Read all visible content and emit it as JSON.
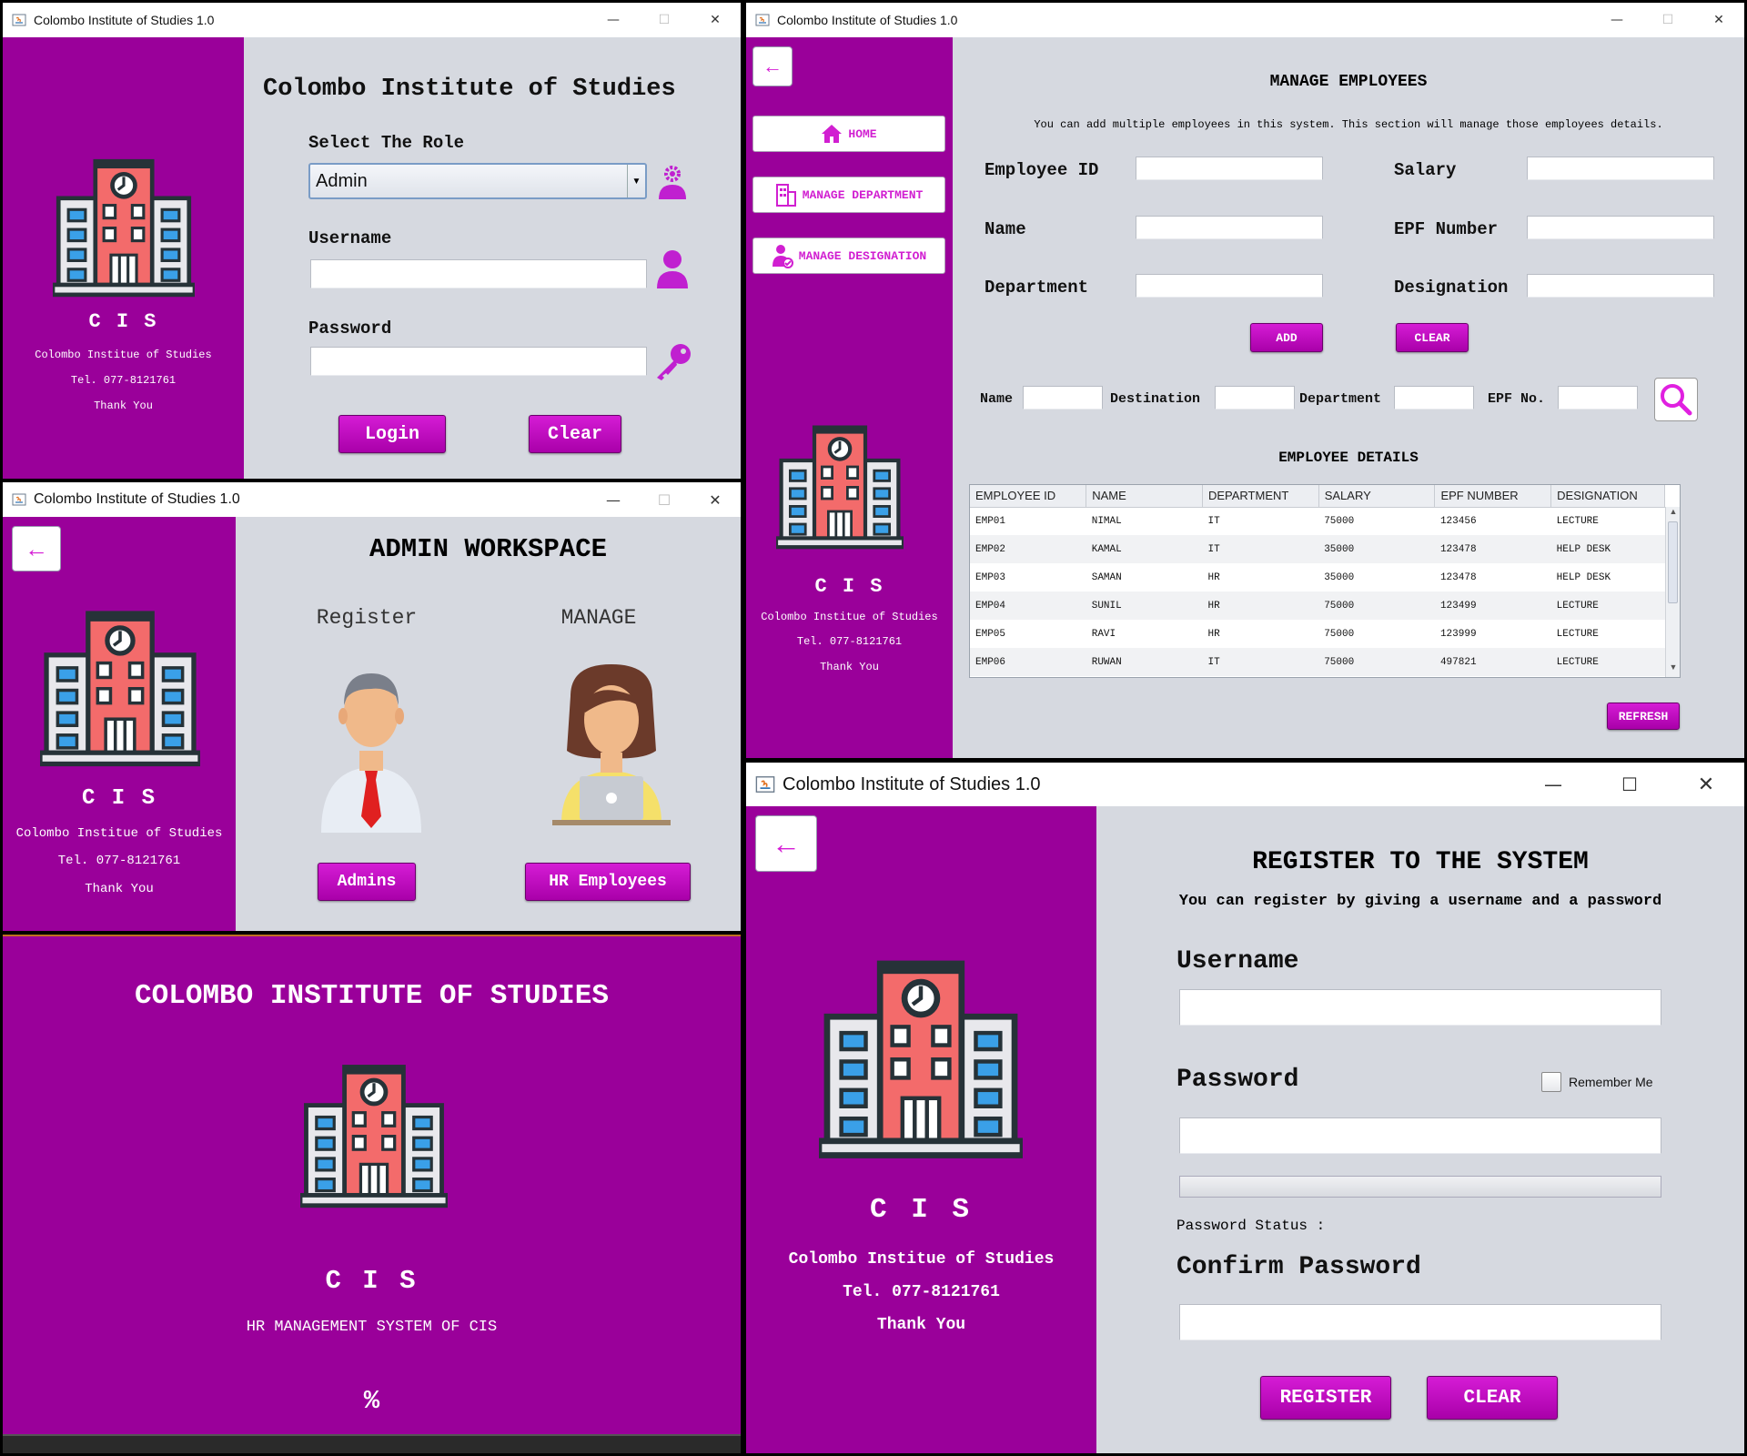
{
  "app": {
    "title": "Colombo Institute of Studies 1.0"
  },
  "brand": {
    "abbr": "C I S",
    "name": "Colombo Institue of Studies",
    "tel": "Tel. 077-8121761",
    "thanks": "Thank You"
  },
  "colors": {
    "purple": "#9a009a",
    "magenta": "#d51cd5",
    "panel": "#d6d9e0"
  },
  "login": {
    "heading": "Colombo Institute of Studies",
    "role_label": "Select The Role",
    "role_value": "Admin",
    "username_label": "Username",
    "password_label": "Password",
    "login_button": "Login",
    "clear_button": "Clear"
  },
  "admin": {
    "heading": "ADMIN WORKSPACE",
    "register_label": "Register",
    "manage_label": "MANAGE",
    "admins_button": "Admins",
    "hr_button": "HR Employees"
  },
  "splash": {
    "heading": "COLOMBO INSTITUTE OF STUDIES",
    "abbr": "C I S",
    "subtitle": "HR MANAGEMENT SYSTEM OF CIS",
    "percent": "%",
    "progress": 0
  },
  "manage": {
    "nav": {
      "home": "HOME",
      "department": "MANAGE DEPARTMENT",
      "designation": "MANAGE DESIGNATION"
    },
    "heading": "MANAGE EMPLOYEES",
    "description": "You can add multiple employees in this system. This section will manage those employees details.",
    "fields": {
      "employee_id": "Employee ID",
      "salary": "Salary",
      "name": "Name",
      "epf": "EPF Number",
      "department": "Department",
      "designation": "Designation"
    },
    "add_button": "ADD",
    "clear_button": "CLEAR",
    "search": {
      "name": "Name",
      "destination": "Destination",
      "department": "Department",
      "epf": "EPF No."
    },
    "table_title": "EMPLOYEE DETAILS",
    "columns": [
      "EMPLOYEE ID",
      "NAME",
      "DEPARTMENT",
      "SALARY",
      "EPF NUMBER",
      "DESIGNATION"
    ],
    "rows": [
      [
        "EMP01",
        "NIMAL",
        "IT",
        "75000",
        "123456",
        "LECTURE"
      ],
      [
        "EMP02",
        "KAMAL",
        "IT",
        "35000",
        "123478",
        "HELP DESK"
      ],
      [
        "EMP03",
        "SAMAN",
        "HR",
        "35000",
        "123478",
        "HELP DESK"
      ],
      [
        "EMP04",
        "SUNIL",
        "HR",
        "75000",
        "123499",
        "LECTURE"
      ],
      [
        "EMP05",
        "RAVI",
        "HR",
        "75000",
        "123999",
        "LECTURE"
      ],
      [
        "EMP06",
        "RUWAN",
        "IT",
        "75000",
        "497821",
        "LECTURE"
      ]
    ],
    "refresh_button": "REFRESH"
  },
  "register": {
    "heading": "REGISTER TO THE SYSTEM",
    "subheading": "You can register by giving a username and a password",
    "username_label": "Username",
    "password_label": "Password",
    "remember_label": "Remember Me",
    "status_label": "Password Status :",
    "confirm_label": "Confirm Password",
    "register_button": "REGISTER",
    "clear_button": "CLEAR"
  }
}
